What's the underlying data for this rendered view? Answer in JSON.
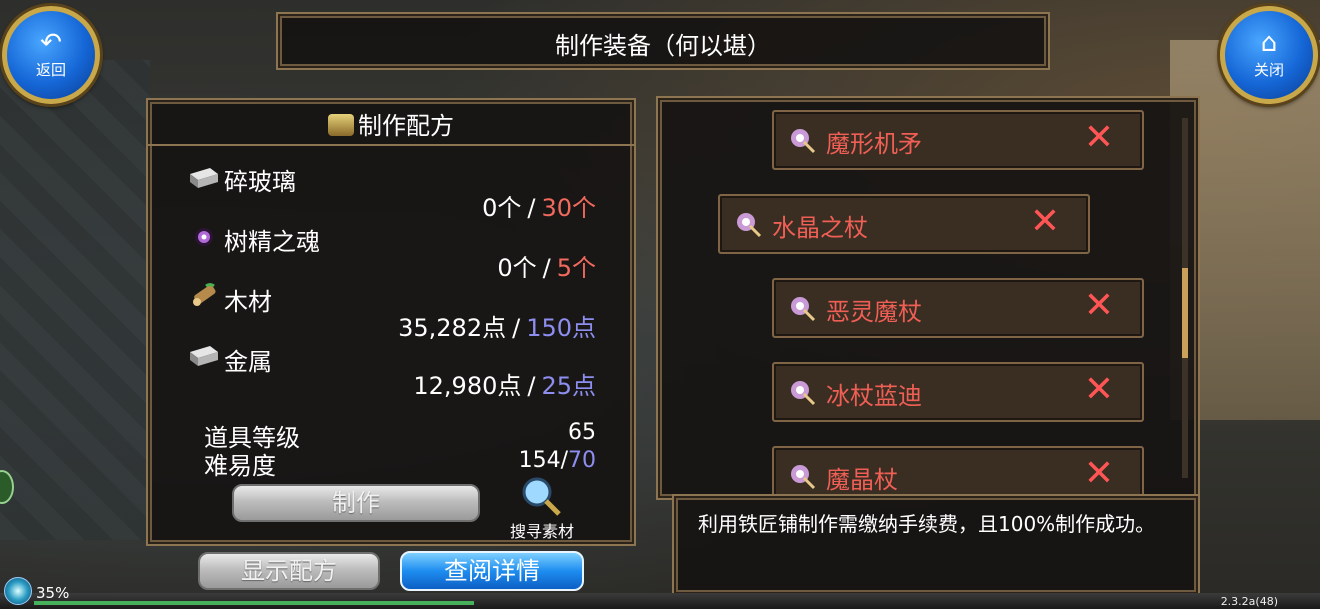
{
  "header": {
    "title": "制作装备（何以堪）",
    "back_label": "返回",
    "close_label": "关闭"
  },
  "recipe": {
    "title": "制作配方",
    "materials": [
      {
        "name": "碎玻璃",
        "icon": "metal-ingot-icon",
        "have": "0个",
        "need": "30个",
        "need_color": "#f26a5e"
      },
      {
        "name": "树精之魂",
        "icon": "purple-orb-icon",
        "have": "0个",
        "need": "5个",
        "need_color": "#f26a5e"
      },
      {
        "name": "木材",
        "icon": "wood-log-icon",
        "have": "35,282点",
        "need": "150点",
        "need_color": "#8e8ef0"
      },
      {
        "name": "金属",
        "icon": "metal-ingot-icon",
        "have": "12,980点",
        "need": "25点",
        "need_color": "#8e8ef0"
      }
    ],
    "separator": "/",
    "item_level_label": "道具等级",
    "item_level_value": "65",
    "difficulty_label": "难易度",
    "difficulty_current": "154",
    "difficulty_required": "70",
    "craft_button": "制作",
    "search_label": "搜寻素材"
  },
  "bottom_buttons": {
    "show_recipe": "显示配方",
    "view_details": "查阅详情"
  },
  "item_list": [
    {
      "name": "魔形机矛",
      "icon": "staff-icon"
    },
    {
      "name": "水晶之杖",
      "icon": "staff-icon"
    },
    {
      "name": "恶灵魔杖",
      "icon": "staff-icon"
    },
    {
      "name": "冰杖蓝迪",
      "icon": "staff-icon"
    },
    {
      "name": "魔晶杖",
      "icon": "staff-icon"
    }
  ],
  "description": "利用铁匠铺制作需缴纳手续费，且100%制作成功。",
  "status": {
    "percent": "35%",
    "progress_fraction": 0.35,
    "version": "2.3.2a(48)"
  },
  "colors": {
    "accent_gold": "#c9a84a",
    "need_red": "#f26a5e",
    "need_blue": "#8e8ef0",
    "item_name_red": "#f05f56"
  }
}
